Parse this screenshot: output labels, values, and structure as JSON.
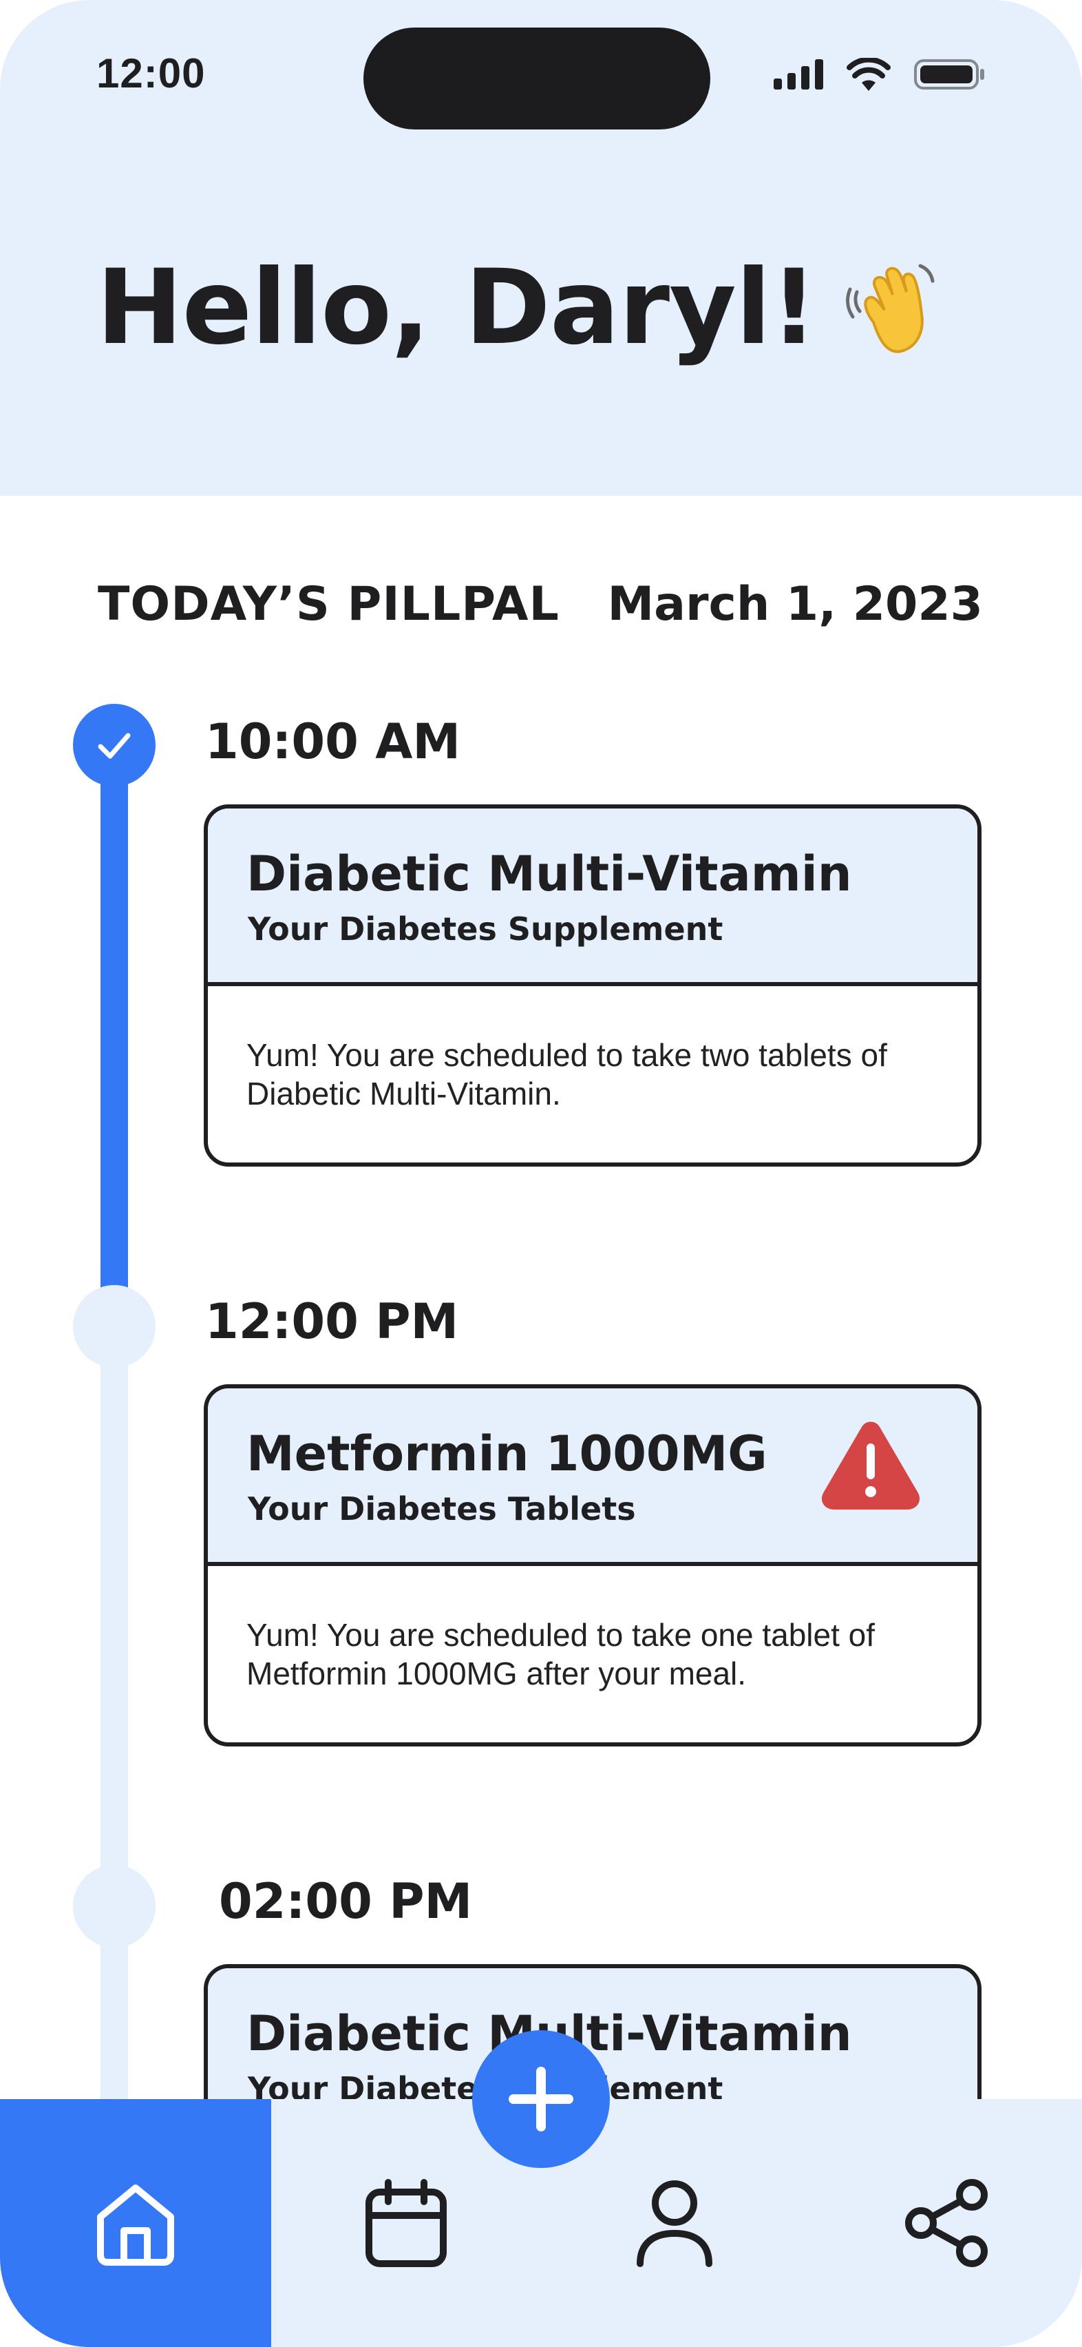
{
  "status_bar": {
    "time": "12:00"
  },
  "header": {
    "greeting": "Hello, Daryl!"
  },
  "schedule": {
    "label": "TODAY’S PILLPAL",
    "date": "March 1, 2023"
  },
  "entries": [
    {
      "time": "10:00 AM",
      "status": "taken",
      "title": "Diabetic Multi-Vitamin",
      "subtitle": "Your Diabetes Supplement",
      "body": "Yum! You are scheduled to take two tablets of Diabetic Multi-Vitamin.",
      "alert": false
    },
    {
      "time": "12:00 PM",
      "status": "upcoming",
      "title": "Metformin 1000MG",
      "subtitle": "Your Diabetes Tablets",
      "body": "Yum! You are scheduled to take one tablet of Metformin 1000MG after your meal.",
      "alert": true
    },
    {
      "time": "02:00 PM",
      "status": "upcoming",
      "title": "Diabetic Multi-Vitamin",
      "subtitle": "Your Diabetes Supplement",
      "body": "",
      "alert": false
    }
  ],
  "nav": {
    "items": [
      {
        "icon": "home-icon",
        "active": true
      },
      {
        "icon": "calendar-icon",
        "active": false
      },
      {
        "icon": "add-icon",
        "active": false
      },
      {
        "icon": "profile-icon",
        "active": false
      },
      {
        "icon": "share-icon",
        "active": false
      }
    ]
  },
  "colors": {
    "accent": "#3478f6",
    "light": "#e6f0fc",
    "alert": "#d64545",
    "ink": "#1f1f21"
  }
}
